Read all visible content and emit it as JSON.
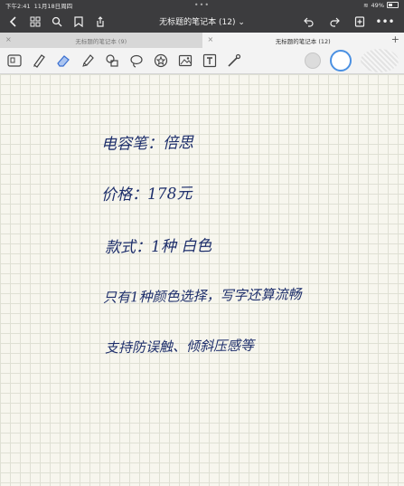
{
  "status": {
    "time": "下午2:41",
    "date": "11月18日周四",
    "battery": "49%"
  },
  "title": "无标题的笔记本 (12)",
  "tabs": [
    {
      "label": "无标题的笔记本 (9)",
      "active": false
    },
    {
      "label": "无标题的笔记本 (12)",
      "active": true
    }
  ],
  "note_lines": [
    "电容笔：倍思",
    "价格：178元",
    "款式：1种 白色",
    "只有1种颜色选择，写字还算流畅",
    "支持防误触、倾斜压感等"
  ],
  "colors": {
    "accent": "#4a90e2",
    "ink": "#1d2e6b"
  }
}
